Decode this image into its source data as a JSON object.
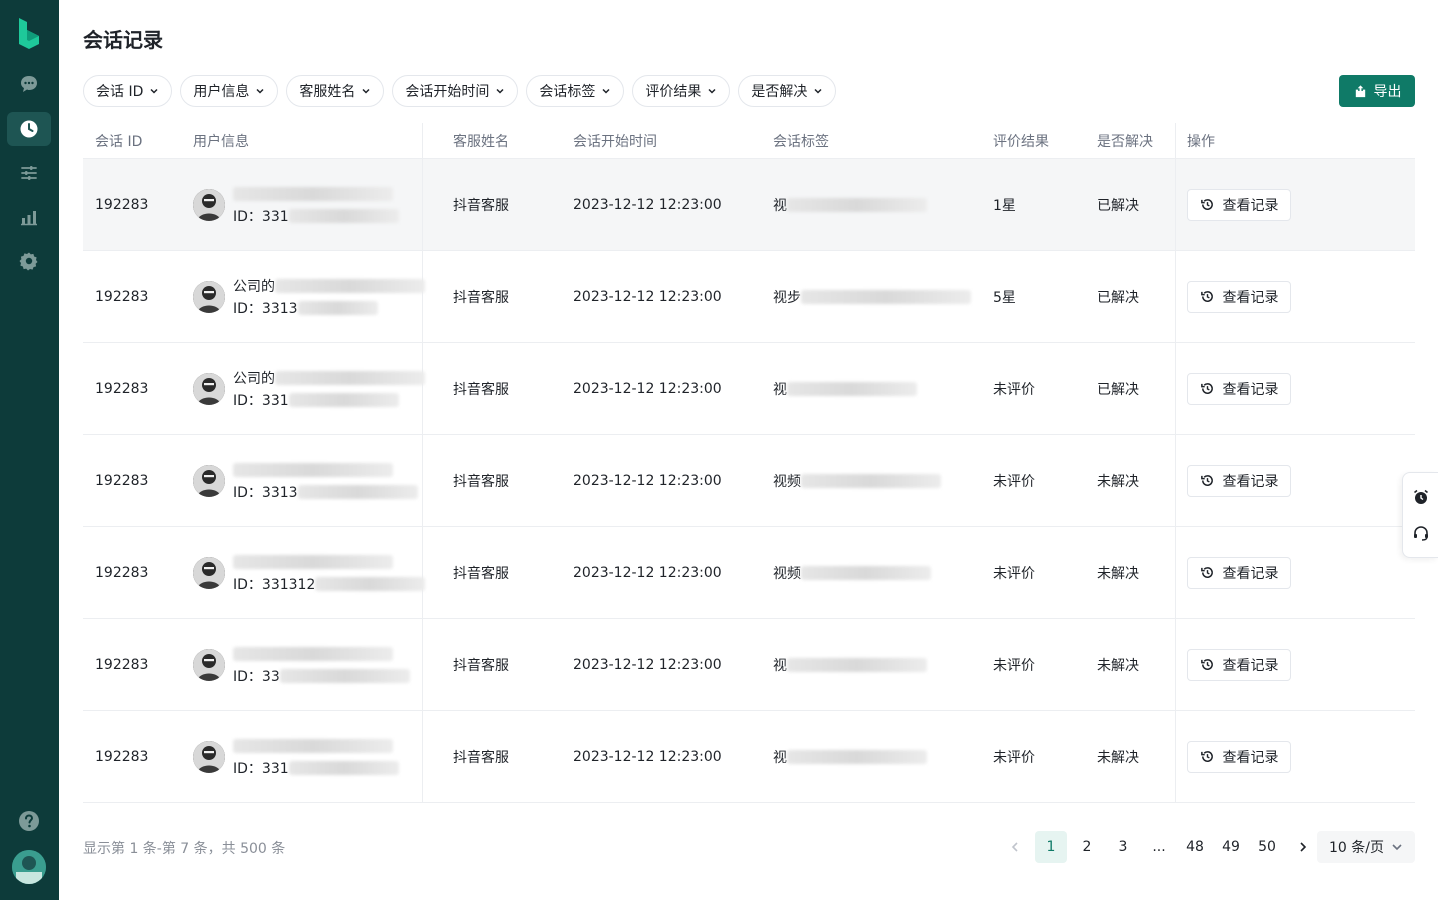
{
  "page": {
    "title": "会话记录"
  },
  "sidebar": {
    "items": [
      {
        "icon": "chat-icon",
        "active": false
      },
      {
        "icon": "clock-icon",
        "active": true
      },
      {
        "icon": "sliders-icon",
        "active": false
      },
      {
        "icon": "bar-chart-icon",
        "active": false
      },
      {
        "icon": "gear-icon",
        "active": false
      }
    ],
    "help_icon": "help-icon"
  },
  "filters": [
    {
      "label": "会话 ID"
    },
    {
      "label": "用户信息"
    },
    {
      "label": "客服姓名"
    },
    {
      "label": "会话开始时间"
    },
    {
      "label": "会话标签"
    },
    {
      "label": "评价结果"
    },
    {
      "label": "是否解决"
    }
  ],
  "toolbar": {
    "export_label": "导出"
  },
  "table": {
    "columns": {
      "id": "会话 ID",
      "user": "用户信息",
      "agent": "客服姓名",
      "time": "会话开始时间",
      "tag": "会话标签",
      "rating": "评价结果",
      "resolved": "是否解决",
      "op": "操作"
    },
    "rows": [
      {
        "id": "192283",
        "name": "",
        "uid": "ID：331",
        "agent": "抖音客服",
        "time": "2023-12-12 12:23:00",
        "tag": "视",
        "rating": "1星",
        "resolved": "已解决",
        "action": "查看记录"
      },
      {
        "id": "192283",
        "name": "公司的",
        "uid": "ID：3313",
        "agent": "抖音客服",
        "time": "2023-12-12 12:23:00",
        "tag": "视步",
        "rating": "5星",
        "resolved": "已解决",
        "action": "查看记录"
      },
      {
        "id": "192283",
        "name": "公司的",
        "uid": "ID：331",
        "agent": "抖音客服",
        "time": "2023-12-12 12:23:00",
        "tag": "视",
        "rating": "未评价",
        "resolved": "已解决",
        "action": "查看记录"
      },
      {
        "id": "192283",
        "name": "",
        "uid": "ID：3313",
        "agent": "抖音客服",
        "time": "2023-12-12 12:23:00",
        "tag": "视频",
        "rating": "未评价",
        "resolved": "未解决",
        "action": "查看记录"
      },
      {
        "id": "192283",
        "name": "",
        "uid": "ID：331312",
        "agent": "抖音客服",
        "time": "2023-12-12 12:23:00",
        "tag": "视频",
        "rating": "未评价",
        "resolved": "未解决",
        "action": "查看记录"
      },
      {
        "id": "192283",
        "name": "",
        "uid": "ID：33",
        "agent": "抖音客服",
        "time": "2023-12-12 12:23:00",
        "tag": "视",
        "rating": "未评价",
        "resolved": "未解决",
        "action": "查看记录"
      },
      {
        "id": "192283",
        "name": "",
        "uid": "ID：331",
        "agent": "抖音客服",
        "time": "2023-12-12 12:23:00",
        "tag": "视",
        "rating": "未评价",
        "resolved": "未解决",
        "action": "查看记录"
      }
    ]
  },
  "footer": {
    "summary": "显示第 1 条-第 7 条，共 500 条",
    "pages": [
      "1",
      "2",
      "3",
      "...",
      "48",
      "49",
      "50"
    ],
    "current_page": "1",
    "page_size": "10 条/页"
  },
  "colors": {
    "sidebar_bg": "#0d3b3a",
    "primary": "#0f7a67",
    "current_page_bg": "#e6f4f1"
  }
}
